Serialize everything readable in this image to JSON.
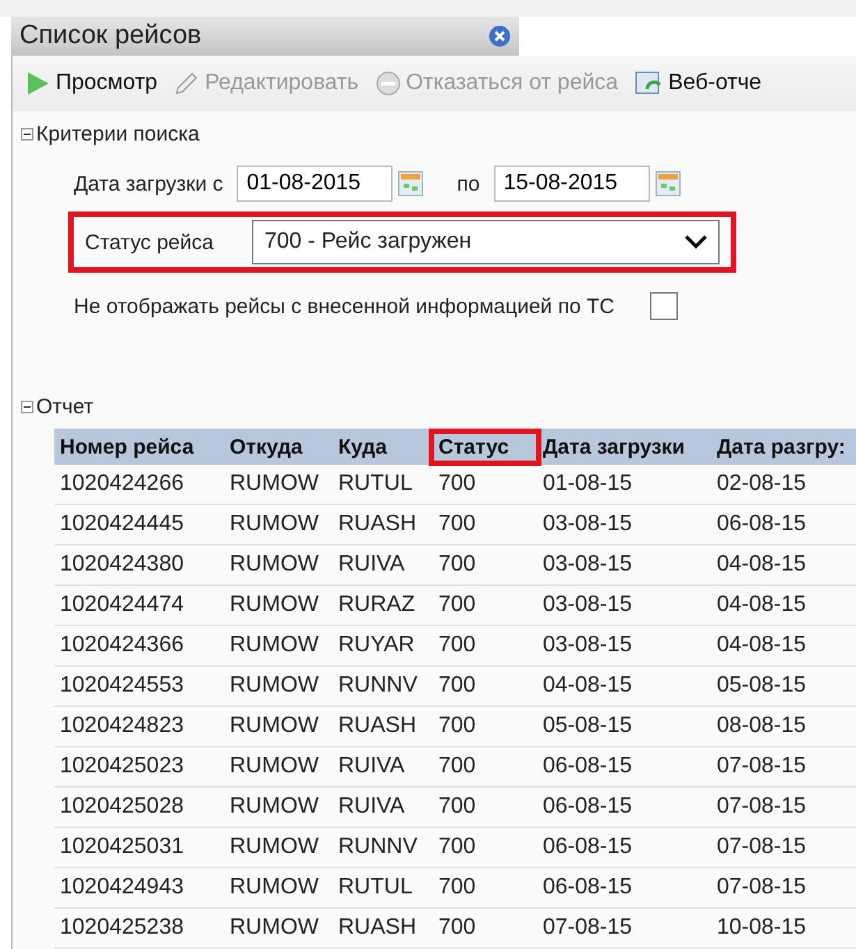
{
  "window": {
    "title": "Список рейсов"
  },
  "toolbar": [
    {
      "label": "Просмотр",
      "kind": "play",
      "disabled": false
    },
    {
      "label": "Редактировать",
      "kind": "pencil",
      "disabled": true
    },
    {
      "label": "Отказаться от рейса",
      "kind": "cancel",
      "disabled": true
    },
    {
      "label": "Веб-отче",
      "kind": "report",
      "disabled": false
    }
  ],
  "criteria": {
    "title": "Критерии поиска",
    "expanded": true,
    "date_from_label": "Дата загрузки с",
    "date_from": "01-08-2015",
    "date_to_label": "по",
    "date_to": "15-08-2015",
    "status_label": "Статус рейса",
    "status_value": "700 - Рейс загружен",
    "status_highlighted": true,
    "hide_label": "Не отображать рейсы с внесенной информацией по ТС",
    "hide_checked": false
  },
  "report": {
    "title": "Отчет",
    "expanded": true
  },
  "table": {
    "columns": [
      {
        "label": "Номер рейса",
        "highlighted": false
      },
      {
        "label": "Откуда",
        "highlighted": false
      },
      {
        "label": "Куда",
        "highlighted": false
      },
      {
        "label": "Статус",
        "highlighted": true
      },
      {
        "label": "Дата загрузки",
        "highlighted": false
      },
      {
        "label": "Дата разгру:",
        "highlighted": false
      }
    ],
    "rows": [
      [
        "1020424266",
        "RUMOW",
        "RUTUL",
        "700",
        "01-08-15",
        "02-08-15"
      ],
      [
        "1020424445",
        "RUMOW",
        "RUASH",
        "700",
        "03-08-15",
        "06-08-15"
      ],
      [
        "1020424380",
        "RUMOW",
        "RUIVA",
        "700",
        "03-08-15",
        "04-08-15"
      ],
      [
        "1020424474",
        "RUMOW",
        "RURAZ",
        "700",
        "03-08-15",
        "04-08-15"
      ],
      [
        "1020424366",
        "RUMOW",
        "RUYAR",
        "700",
        "03-08-15",
        "04-08-15"
      ],
      [
        "1020424553",
        "RUMOW",
        "RUNNV",
        "700",
        "04-08-15",
        "05-08-15"
      ],
      [
        "1020424823",
        "RUMOW",
        "RUASH",
        "700",
        "05-08-15",
        "08-08-15"
      ],
      [
        "1020425023",
        "RUMOW",
        "RUIVA",
        "700",
        "06-08-15",
        "07-08-15"
      ],
      [
        "1020425028",
        "RUMOW",
        "RUIVA",
        "700",
        "06-08-15",
        "07-08-15"
      ],
      [
        "1020425031",
        "RUMOW",
        "RUNNV",
        "700",
        "06-08-15",
        "07-08-15"
      ],
      [
        "1020424943",
        "RUMOW",
        "RUTUL",
        "700",
        "06-08-15",
        "07-08-15"
      ],
      [
        "1020425238",
        "RUMOW",
        "RUASH",
        "700",
        "07-08-15",
        "10-08-15"
      ]
    ]
  }
}
